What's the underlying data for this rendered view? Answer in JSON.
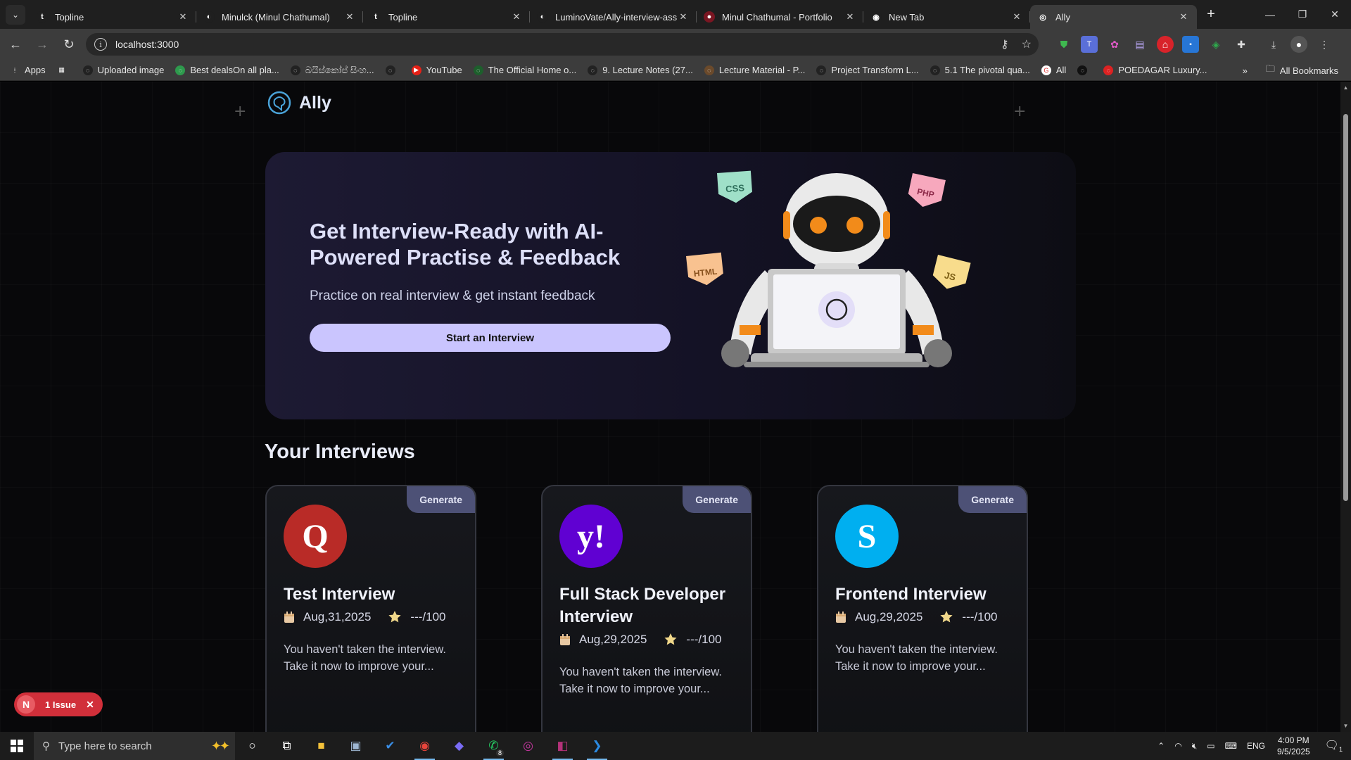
{
  "browser": {
    "tabs": [
      {
        "title": "Topline",
        "favicon": "t",
        "fav_color": "#1f1f1f",
        "active": false
      },
      {
        "title": "Minulck (Minul Chathumal)",
        "favicon": "github-icon",
        "fav_color": "#1f1f1f",
        "active": false
      },
      {
        "title": "Topline",
        "favicon": "t",
        "fav_color": "#1f1f1f",
        "active": false
      },
      {
        "title": "LuminoVate/Ally-interview-assi",
        "favicon": "github-icon",
        "fav_color": "#1f1f1f",
        "active": false
      },
      {
        "title": "Minul Chathumal - Portfolio",
        "favicon": "portfolio-icon",
        "fav_color": "#7a1622",
        "active": false
      },
      {
        "title": "New Tab",
        "favicon": "chrome-icon",
        "fav_color": "#1f1f1f",
        "active": false
      },
      {
        "title": "Ally",
        "favicon": "ally-icon",
        "fav_color": "#3c3c3c",
        "active": true
      }
    ],
    "url": "localhost:3000",
    "bookmarks": [
      {
        "label": "Apps",
        "icon": "apps-icon",
        "color": "#3c3c3c"
      },
      {
        "label": "",
        "icon": "grid-icon",
        "color": "#3c3c3c"
      },
      {
        "label": "Uploaded image",
        "icon": "globe-icon",
        "color": "#222"
      },
      {
        "label": "Best dealsOn all pla...",
        "icon": "deals-icon",
        "color": "#2e9a4d"
      },
      {
        "label": "බයිස්කෝප් සිංහ...",
        "icon": "globe-icon",
        "color": "#222"
      },
      {
        "label": "",
        "icon": "globe-icon",
        "color": "#222"
      },
      {
        "label": "YouTube",
        "icon": "youtube-icon",
        "color": "#e62117"
      },
      {
        "label": "The Official Home o...",
        "icon": "leaf-icon",
        "color": "#1d5f2c"
      },
      {
        "label": "9. Lecture Notes (27...",
        "icon": "globe-icon",
        "color": "#222"
      },
      {
        "label": "Lecture Material - P...",
        "icon": "figure-icon",
        "color": "#6b4a2b"
      },
      {
        "label": "Project Transform L...",
        "icon": "globe-icon",
        "color": "#222"
      },
      {
        "label": "5.1 The pivotal qua...",
        "icon": "globe-icon",
        "color": "#222"
      },
      {
        "label": "All",
        "icon": "google-icon",
        "color": "#ffffff"
      },
      {
        "label": "",
        "icon": "dark-icon",
        "color": "#111"
      },
      {
        "label": "POEDAGAR Luxury...",
        "icon": "shop-icon",
        "color": "#d22"
      }
    ],
    "all_bookmarks": "All Bookmarks",
    "overflow": "»"
  },
  "page": {
    "brand": "Ally",
    "hero": {
      "title": "Get Interview-Ready with AI-Powered Practise & Feedback",
      "subtitle": "Practice on real interview & get instant feedback",
      "cta": "Start an Interview",
      "badges": [
        "CSS",
        "PHP",
        "HTML",
        "JS"
      ]
    },
    "section_title": "Your Interviews",
    "interviews": [
      {
        "company_icon": "quora-icon",
        "company_glyph": "Q",
        "color": "#b92b27",
        "badge": "Generate",
        "title": "Test Interview",
        "date": "Aug,31,2025",
        "score": "---/100",
        "description": "You haven't taken the interview. Take it now to improve your..."
      },
      {
        "company_icon": "yahoo-icon",
        "company_glyph": "y!",
        "color": "#6001d2",
        "badge": "Generate",
        "title": "Full Stack Developer Interview",
        "date": "Aug,29,2025",
        "score": "---/100",
        "description": "You haven't taken the interview. Take it now to improve your..."
      },
      {
        "company_icon": "skype-icon",
        "company_glyph": "S",
        "color": "#00aff0",
        "badge": "Generate",
        "title": "Frontend Interview",
        "date": "Aug,29,2025",
        "score": "---/100",
        "description": "You haven't taken the interview. Take it now to improve your..."
      }
    ],
    "issue_badge": {
      "letter": "N",
      "label": "1 Issue"
    }
  },
  "taskbar": {
    "search_placeholder": "Type here to search",
    "apps": [
      {
        "name": "cortana-icon",
        "glyph": "○",
        "color": "#fff"
      },
      {
        "name": "task-view-icon",
        "glyph": "⧉",
        "color": "#fff"
      },
      {
        "name": "file-explorer-icon",
        "glyph": "■",
        "color": "#f3c13a"
      },
      {
        "name": "network-app-icon",
        "glyph": "▣",
        "color": "#9fb7d3"
      },
      {
        "name": "todo-icon",
        "glyph": "✔",
        "color": "#3a8ee6"
      },
      {
        "name": "chrome-icon",
        "glyph": "◉",
        "color": "#e8453c"
      },
      {
        "name": "copilot-icon",
        "glyph": "◆",
        "color": "#7a6cf5"
      },
      {
        "name": "whatsapp-icon",
        "glyph": "✆",
        "color": "#25d366"
      },
      {
        "name": "camera-app-icon",
        "glyph": "◎",
        "color": "#c2369d"
      },
      {
        "name": "pdf-app-icon",
        "glyph": "◧",
        "color": "#b4327a"
      },
      {
        "name": "vscode-icon",
        "glyph": "❯",
        "color": "#2b8ae2"
      }
    ],
    "whatsapp_count": "8",
    "language": "ENG",
    "time": "4:00 PM",
    "date": "9/5/2025",
    "notifications": "1"
  }
}
